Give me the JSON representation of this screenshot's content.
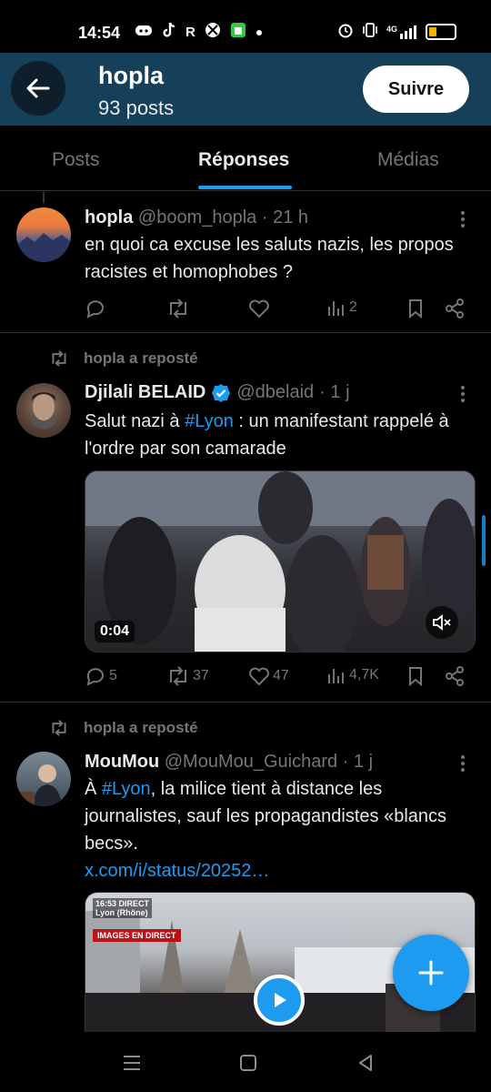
{
  "status_bar": {
    "time": "14:54",
    "left_icons": [
      "discord-icon",
      "tiktok-icon",
      "r-icon",
      "xbox-icon",
      "app-icon",
      "dot-icon"
    ],
    "r_letter": "R",
    "network": "4G",
    "battery_color": "#f0b400"
  },
  "header": {
    "name": "hopla",
    "posts_count": "93 posts",
    "follow_label": "Suivre",
    "background": "#16405a"
  },
  "tabs": [
    {
      "label": "Posts"
    },
    {
      "label": "Réponses"
    },
    {
      "label": "Médias"
    }
  ],
  "posts": [
    {
      "author": "hopla",
      "handle": "@boom_hopla",
      "time": "· 21 h",
      "text": "en quoi ca excuse les saluts nazis, les propos racistes et homophobes ?",
      "views": "2"
    },
    {
      "repost_label": "hopla a reposté",
      "author": "Djilali BELAID",
      "verified": true,
      "handle": "@dbelaid",
      "time": "· 1 j",
      "text_before": "Salut nazi à ",
      "hashtag": "#Lyon",
      "text_after": " : un manifestant rappelé à l'ordre par son camarade",
      "video_duration": "0:04",
      "replies": "5",
      "reposts": "37",
      "likes": "47",
      "views": "4,7K"
    },
    {
      "repost_label": "hopla a reposté",
      "author": "MouMou",
      "handle": "@MouMou_Guichard",
      "time": "· 1 j",
      "text_before": "À ",
      "hashtag": "#Lyon",
      "text_after": ", la milice tient à distance les journalistes, sauf les propagandistes «blancs becs».",
      "link": "x.com/i/status/20252…",
      "overlay_time": "16:53 DIRECT",
      "overlay_place": "Lyon (Rhône)",
      "overlay_label": "IMAGES EN DIRECT"
    }
  ],
  "accent_color": "#1d9bf0"
}
